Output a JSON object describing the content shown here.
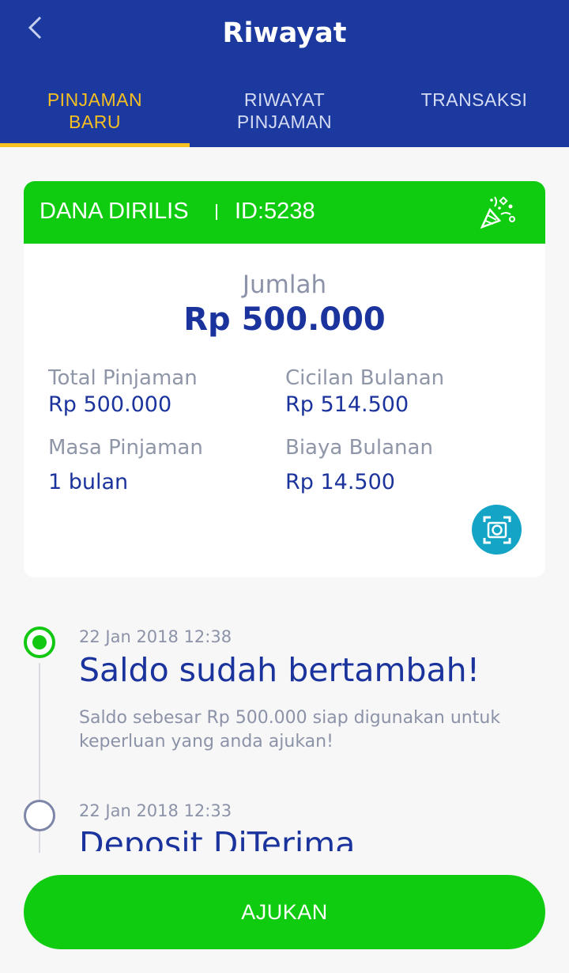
{
  "header": {
    "title": "Riwayat",
    "back_icon": "chevron-left-icon",
    "tabs": [
      {
        "label": "PINJAMAN\nBARU",
        "active": true
      },
      {
        "label": "RIWAYAT\nPINJAMAN",
        "active": false
      },
      {
        "label": "TRANSAKSI",
        "active": false
      }
    ]
  },
  "loan_card": {
    "status": "DANA DIRILIS",
    "id": "ID:5238",
    "status_color": "#10cc10",
    "amount_label": "Jumlah",
    "amount_value": "Rp 500.000",
    "details": {
      "total_label": "Total Pinjaman",
      "total_value": "Rp 500.000",
      "installment_label": "Cicilan Bulanan",
      "installment_value": "Rp 514.500",
      "period_label": "Masa Pinjaman",
      "period_value": "1 bulan",
      "fee_label": "Biaya Bulanan",
      "fee_value": "Rp 14.500"
    },
    "camera_icon": "camera-icon"
  },
  "timeline": [
    {
      "time": "22 Jan 2018 12:38",
      "title": "Saldo sudah bertambah!",
      "description": "Saldo sebesar Rp 500.000 siap digunakan untuk keperluan yang anda ajukan!",
      "active": true
    },
    {
      "time": "22 Jan 2018 12:33",
      "title": "Deposit DiTerima",
      "active": false
    }
  ],
  "submit_button": "AJUKAN",
  "colors": {
    "header_bg": "#1b399e",
    "accent_tab": "#f6bf22",
    "primary_text": "#1b339c",
    "button_green": "#10cc10"
  }
}
